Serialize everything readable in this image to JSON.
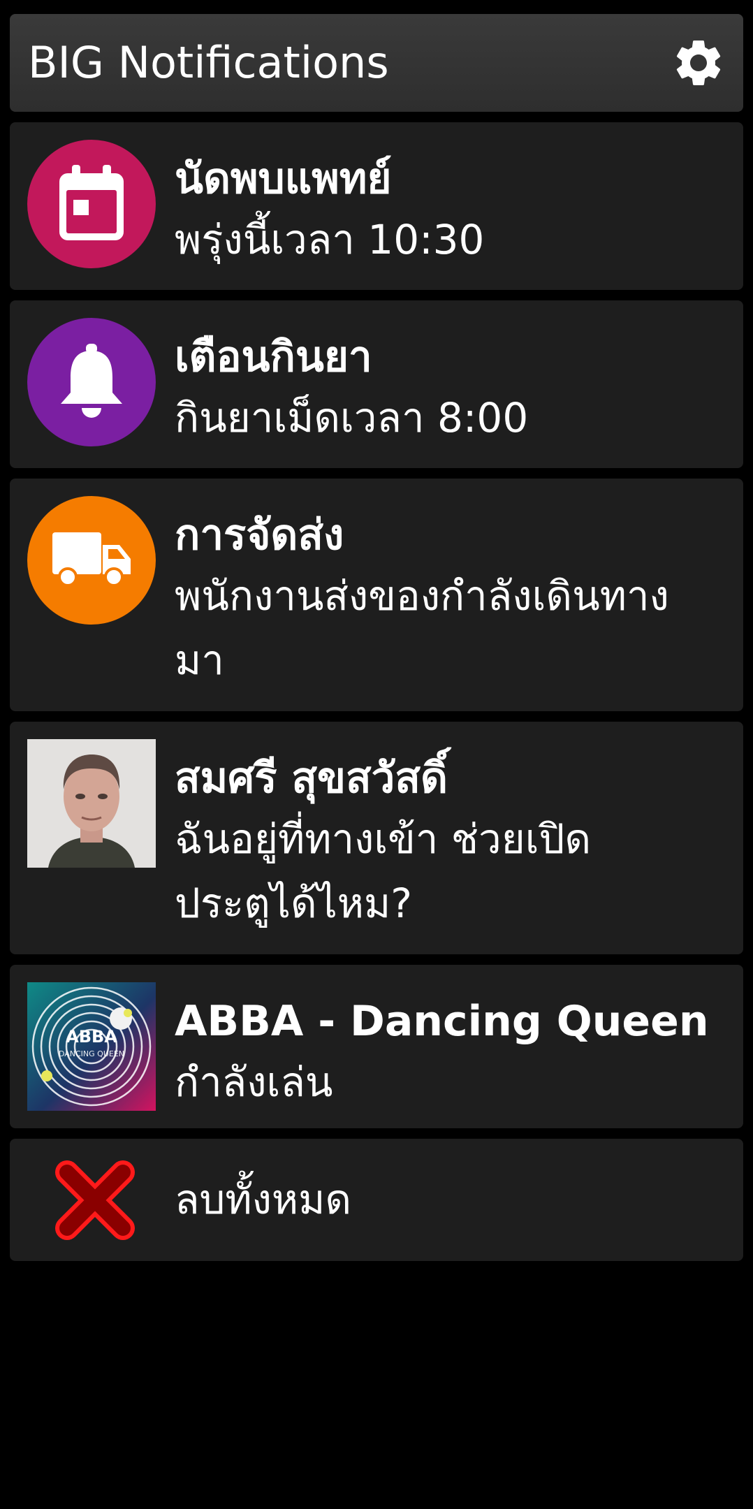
{
  "app": {
    "title": "BIG Notifications",
    "settings_icon": "gear-icon"
  },
  "notifications": [
    {
      "icon": "calendar-icon",
      "icon_bg": "#c2185b",
      "title": "นัดพบแพทย์",
      "body": "พรุ่งนี้เวลา 10:30"
    },
    {
      "icon": "bell-icon",
      "icon_bg": "#7b1fa2",
      "title": "เตือนกินยา",
      "body": "กินยาเม็ดเวลา 8:00"
    },
    {
      "icon": "truck-icon",
      "icon_bg": "#f57c00",
      "title": "การจัดส่ง",
      "body": "พนักงานส่งของกำลังเดินทางมา"
    },
    {
      "icon": "contact-photo",
      "title": "สมศรี สุขสวัสดิ์",
      "body": "ฉันอยู่ที่ทางเข้า ช่วยเปิดประตูได้ไหม?"
    },
    {
      "icon": "album-art",
      "title": "ABBA - Dancing Queen",
      "body": "กำลังเล่น",
      "album_text": "ABBA",
      "album_subtext": "DANCING QUEEN"
    }
  ],
  "clear_all": {
    "icon": "close-icon",
    "icon_color": "#e00000",
    "label": "ลบทั้งหมด"
  },
  "colors": {
    "background": "#000000",
    "card": "#1e1e1e",
    "header": "#333333",
    "text": "#ffffff"
  }
}
